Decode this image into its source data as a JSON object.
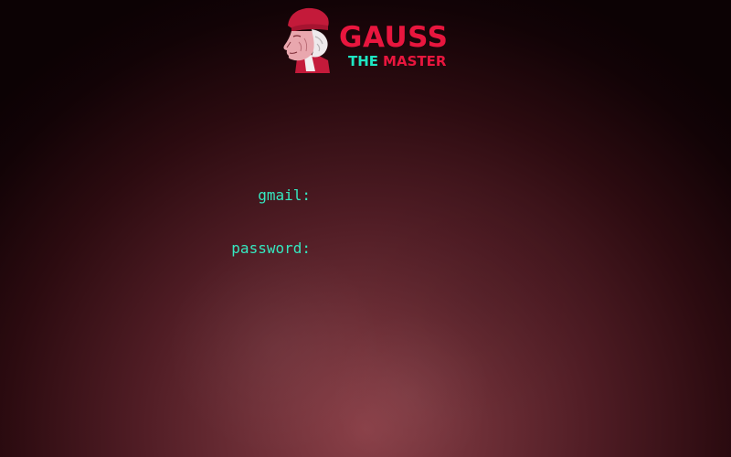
{
  "logo": {
    "title": "GAUSS",
    "sub_the": "THE",
    "sub_master": "MASTER",
    "title_color": "#e8163e",
    "accent_color": "#1ee6c3",
    "icon": "gauss-portrait-icon"
  },
  "form": {
    "gmail_label": "gmail:",
    "gmail_value": "",
    "password_label": "password:",
    "password_value": "",
    "label_color": "#35e8c0"
  }
}
